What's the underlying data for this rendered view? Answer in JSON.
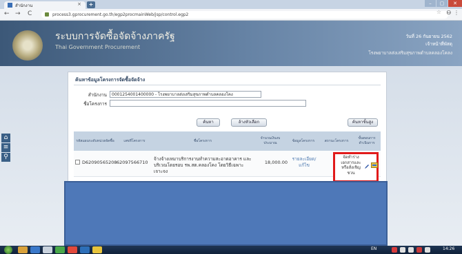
{
  "browser": {
    "tab_title": "สำนักงาน",
    "tab_close": "×",
    "new_tab": "+",
    "url": "process3.gprocurement.go.th/egp2procmainWeb/jsp/control.egp2",
    "min_btn": "–",
    "max_btn": "▢",
    "close_btn": "✕",
    "back": "←",
    "forward": "→",
    "reload": "C",
    "star": "☆",
    "profile": "Ꮎ",
    "menu": "⋮"
  },
  "header": {
    "title": "ระบบการจัดซื้อจัดจ้างภาครัฐ",
    "subtitle": "Thai Government Procurement",
    "date": "วันที่ 26 กันยายน 2562",
    "role": "เจ้าหน้าที่พัสดุ",
    "org": "โรงพยาบาลส่งเสริมสุขภาพตำบลคลองโคลง"
  },
  "sidebar": {
    "icons": [
      "home-icon",
      "menu-icon",
      "search-icon"
    ],
    "glyphs": [
      "⌂",
      "≡",
      "⚲"
    ]
  },
  "panel": {
    "title": "ค้นหาข้อมูลโครงการจัดซื้อจัดจ้าง",
    "agency_label": "สำนักงาน",
    "agency_value": "0001254001400000 - โรงพยาบาลส่งเสริมสุขภาพตำบลคลองโคง",
    "project_label": "ชื่อโครงการ",
    "project_value": "",
    "search_button": "ค้นหา",
    "clear_button": "ล้างหัวเลือก",
    "more_search_button": "ค้นหาขั้นสูง"
  },
  "table": {
    "headers": [
      "รหัสแผนระดับหน่วยจัดซื้อ",
      "เลขที่โครงการ",
      "ชื่อโครงการ",
      "จำนวนเงินงบประมาณ",
      "ข้อมูลโครงการ",
      "สถานะโครงการ",
      "ขั้นตอนการดำเนินการ"
    ],
    "rows": [
      {
        "plan_id": "D62090565208",
        "project_no": "62097566710",
        "name": "จ้างจ้างเหมาบริการงานทำความสะอาดอาคาร และบริเวณโดยรอบ รพ.สต.คลองโคง โดยวิธีเฉพาะเจาะจง",
        "budget": "18,000.00",
        "info": "รายละเอียด/แก้ไข",
        "status": "จัดทำร่างเอกสารและหรือสั่งเชิญชวน"
      }
    ]
  },
  "taskbar": {
    "lang": "EN",
    "time": "14:26"
  },
  "colors": {
    "accent": "#4e78b8",
    "highlight_border": "#e11a1a"
  }
}
